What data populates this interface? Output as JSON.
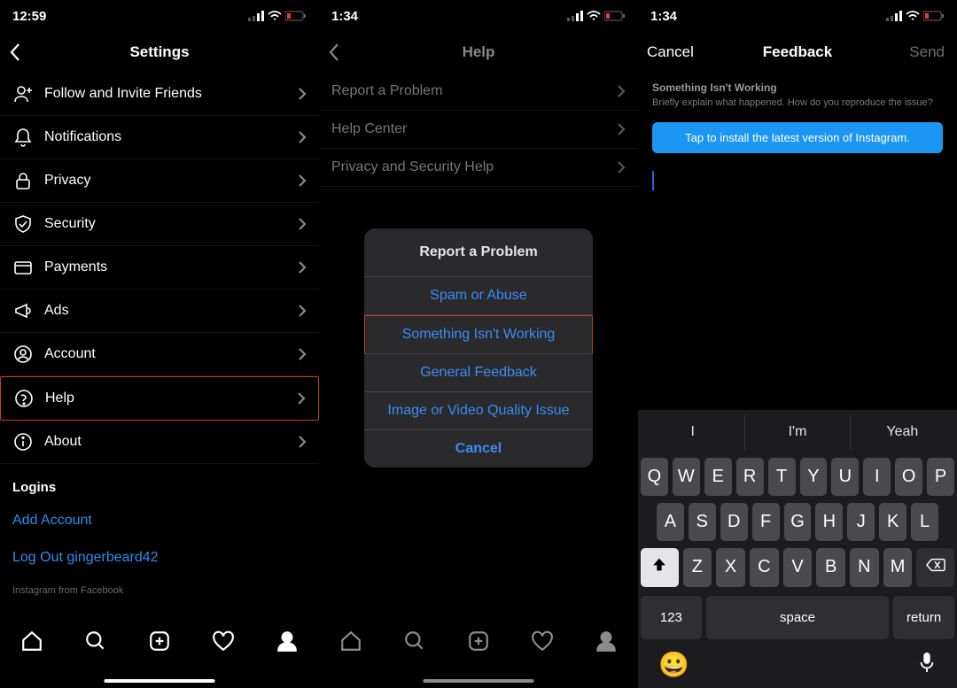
{
  "panel1": {
    "time": "12:59",
    "title": "Settings",
    "rows": {
      "invite": "Follow and Invite Friends",
      "notifications": "Notifications",
      "privacy": "Privacy",
      "security": "Security",
      "payments": "Payments",
      "ads": "Ads",
      "account": "Account",
      "help": "Help",
      "about": "About"
    },
    "logins_header": "Logins",
    "add_account": "Add Account",
    "log_out": "Log Out gingerbeard42",
    "footer": "Instagram from Facebook"
  },
  "panel2": {
    "time": "1:34",
    "title": "Help",
    "rows": {
      "report": "Report a Problem",
      "help_center": "Help Center",
      "privacy_help": "Privacy and Security Help"
    },
    "sheet": {
      "title": "Report a Problem",
      "spam": "Spam or Abuse",
      "not_working": "Something Isn't Working",
      "feedback": "General Feedback",
      "quality": "Image or Video Quality Issue",
      "cancel": "Cancel"
    }
  },
  "panel3": {
    "time": "1:34",
    "cancel": "Cancel",
    "title": "Feedback",
    "send": "Send",
    "hint_title": "Something Isn't Working",
    "hint_body": "Briefly explain what happened. How do you reproduce the issue?",
    "banner": "Tap to install the latest version of Instagram.",
    "suggestions": {
      "a": "I",
      "b": "I'm",
      "c": "Yeah"
    },
    "keys": {
      "row1": [
        "Q",
        "W",
        "E",
        "R",
        "T",
        "Y",
        "U",
        "I",
        "O",
        "P"
      ],
      "row2": [
        "A",
        "S",
        "D",
        "F",
        "G",
        "H",
        "J",
        "K",
        "L"
      ],
      "row3": [
        "Z",
        "X",
        "C",
        "V",
        "B",
        "N",
        "M"
      ],
      "num": "123",
      "space": "space",
      "return": "return"
    }
  }
}
